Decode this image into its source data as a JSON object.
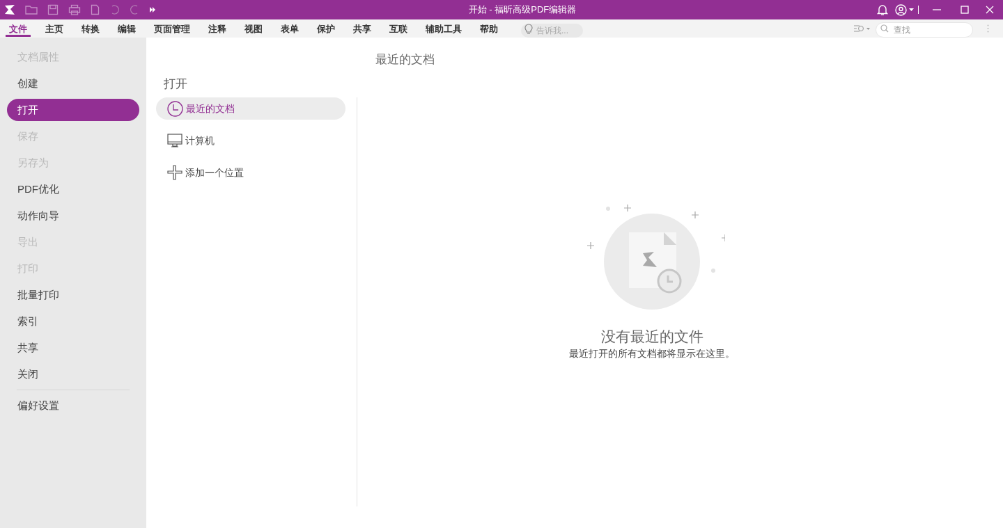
{
  "window": {
    "title": "开始 - 福昕高级PDF编辑器"
  },
  "ribbon_tabs": [
    {
      "label": "文件",
      "selected": true
    },
    {
      "label": "主页",
      "selected": false
    },
    {
      "label": "转换",
      "selected": false
    },
    {
      "label": "编辑",
      "selected": false
    },
    {
      "label": "页面管理",
      "selected": false
    },
    {
      "label": "注释",
      "selected": false
    },
    {
      "label": "视图",
      "selected": false
    },
    {
      "label": "表单",
      "selected": false
    },
    {
      "label": "保护",
      "selected": false
    },
    {
      "label": "共享",
      "selected": false
    },
    {
      "label": "互联",
      "selected": false
    },
    {
      "label": "辅助工具",
      "selected": false
    },
    {
      "label": "帮助",
      "selected": false
    }
  ],
  "tell_me": {
    "placeholder": "告诉我..."
  },
  "search": {
    "placeholder": "查找"
  },
  "sidebar": {
    "items": [
      {
        "label": "文档属性",
        "disabled": true,
        "selected": false
      },
      {
        "label": "创建",
        "disabled": false,
        "selected": false
      },
      {
        "label": "打开",
        "disabled": false,
        "selected": true
      },
      {
        "label": "保存",
        "disabled": true,
        "selected": false
      },
      {
        "label": "另存为",
        "disabled": true,
        "selected": false
      },
      {
        "label": "PDF优化",
        "disabled": false,
        "selected": false
      },
      {
        "label": "动作向导",
        "disabled": false,
        "selected": false
      },
      {
        "label": "导出",
        "disabled": true,
        "selected": false
      },
      {
        "label": "打印",
        "disabled": true,
        "selected": false
      },
      {
        "label": "批量打印",
        "disabled": false,
        "selected": false
      },
      {
        "label": "索引",
        "disabled": false,
        "selected": false
      },
      {
        "label": "共享",
        "disabled": false,
        "selected": false
      },
      {
        "label": "关闭",
        "disabled": false,
        "selected": false
      }
    ],
    "footer_items": [
      {
        "label": "偏好设置",
        "disabled": false,
        "selected": false
      }
    ]
  },
  "open_panel": {
    "title": "打开",
    "locations": [
      {
        "label": "最近的文档",
        "kind": "recent",
        "selected": true
      },
      {
        "label": "计算机",
        "kind": "computer",
        "selected": false
      },
      {
        "label": "添加一个位置",
        "kind": "add",
        "selected": false
      }
    ]
  },
  "recent": {
    "title": "最近的文档",
    "empty_title": "没有最近的文件",
    "empty_message": "最近打开的所有文档都将显示在这里。"
  }
}
